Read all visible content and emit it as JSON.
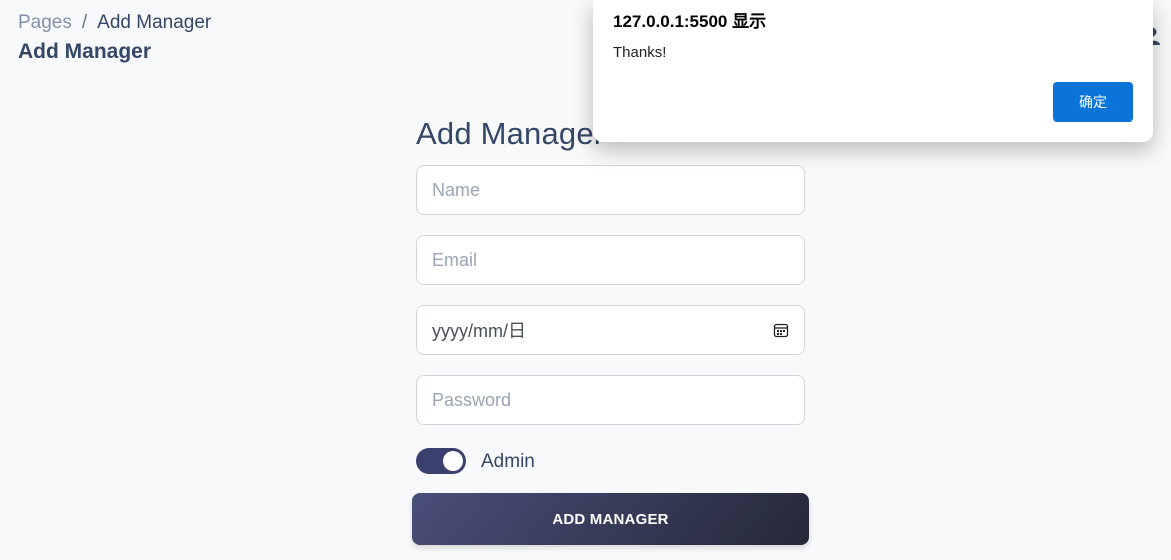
{
  "breadcrumb": {
    "root": "Pages",
    "separator": "/",
    "current": "Add Manager"
  },
  "header": {
    "title": "Add Manager",
    "user_icon": "user-icon"
  },
  "form": {
    "heading": "Add Manager",
    "name_placeholder": "Name",
    "email_placeholder": "Email",
    "date_value": "yyyy/mm/日",
    "date_icon": "calendar-icon",
    "password_placeholder": "Password",
    "admin_label": "Admin",
    "admin_toggle_on": true,
    "submit_label": "ADD MANAGER"
  },
  "dialog": {
    "origin": "127.0.0.1:5500 显示",
    "message": "Thanks!",
    "ok_label": "确定"
  },
  "colors": {
    "page_bg": "#f8f9fa",
    "text_dark": "#344767",
    "toggle_on": "#3a416f",
    "dialog_button": "#0b74d9"
  }
}
